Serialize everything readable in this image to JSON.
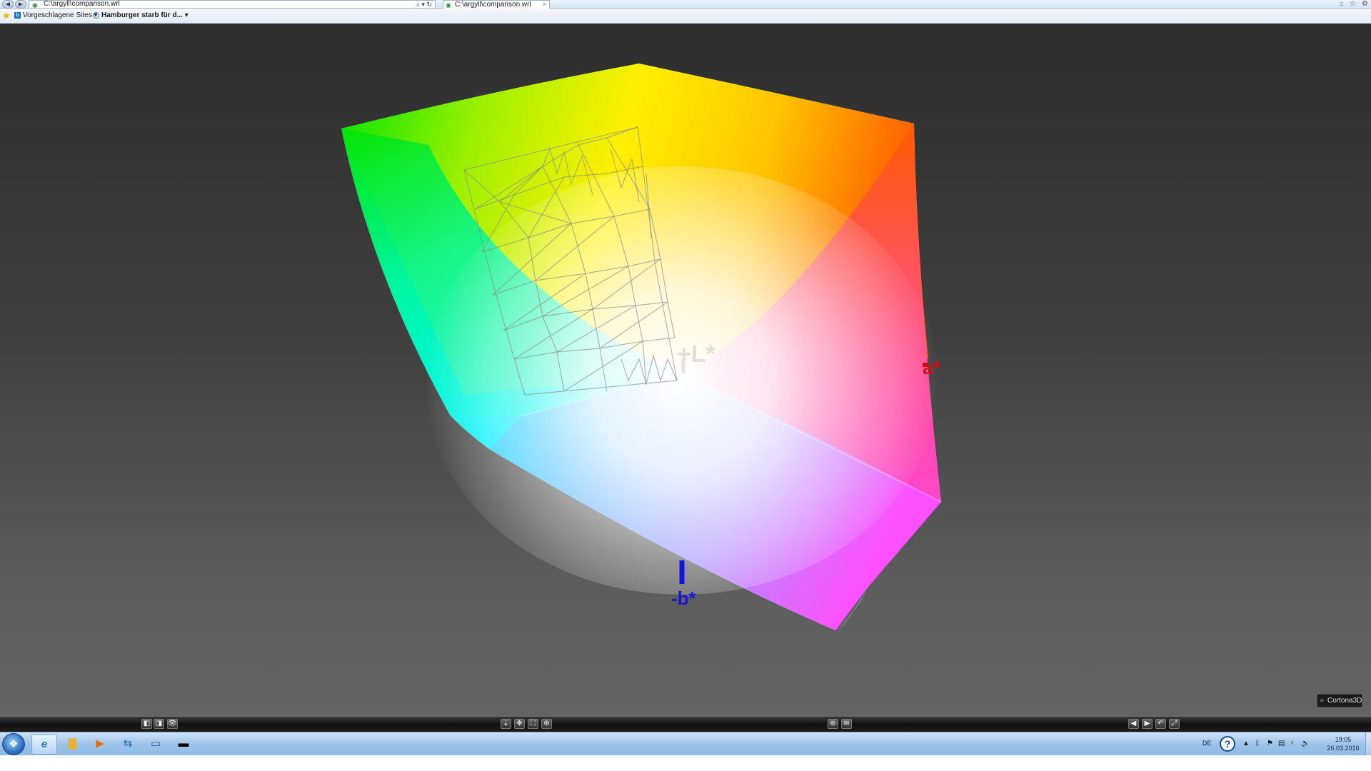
{
  "browser": {
    "address": "C:\\argyll\\comparison.wrl",
    "tab_title": "C:\\argyll\\comparison.wrl",
    "tab_close": "×",
    "addr_tools": "⌕ ▾ ↻",
    "nav_back": "◀",
    "nav_forward": "▶",
    "window_controls": [
      "⌂",
      "☆",
      "⚙"
    ]
  },
  "favorites": {
    "items": [
      {
        "label": "Vorgeschlagene Sites ▾",
        "icon": "blue-square-icon"
      },
      {
        "label": "Hamburger starb für d... ▾",
        "icon": "ie-page-icon"
      }
    ]
  },
  "viewer": {
    "axis_labels": {
      "L": "+L*",
      "b": "-b*",
      "a": "a*"
    },
    "brand": "Cortona3D",
    "colors": {
      "b_axis": "#1515e0",
      "a_axis": "#d01010"
    }
  },
  "navbar": {
    "left_buttons": [
      "◧",
      "◨",
      "👁"
    ],
    "center_buttons": [
      "⇣",
      "✥",
      "⛶",
      "⊕"
    ],
    "mid_buttons": [
      "⊕",
      "✉"
    ],
    "right_buttons": [
      "◀",
      "▶",
      "↶",
      "⤢"
    ]
  },
  "taskbar": {
    "start_icon": "windows-start-icon",
    "start_glyph": "❖",
    "apps": [
      {
        "name": "internet-explorer",
        "glyph": "e"
      },
      {
        "name": "explorer",
        "glyph": "▇"
      },
      {
        "name": "media-player",
        "glyph": "▶"
      },
      {
        "name": "teamviewer",
        "glyph": "⇆"
      },
      {
        "name": "remote-desktop",
        "glyph": "▭"
      },
      {
        "name": "command-prompt",
        "glyph": "▬"
      }
    ],
    "tray": {
      "language": "DE",
      "help": "?",
      "icons": [
        "ᛒ",
        "⚑",
        "▤",
        "⚡",
        "🔈"
      ],
      "time": "19:05",
      "date": "26.03.2016"
    }
  }
}
